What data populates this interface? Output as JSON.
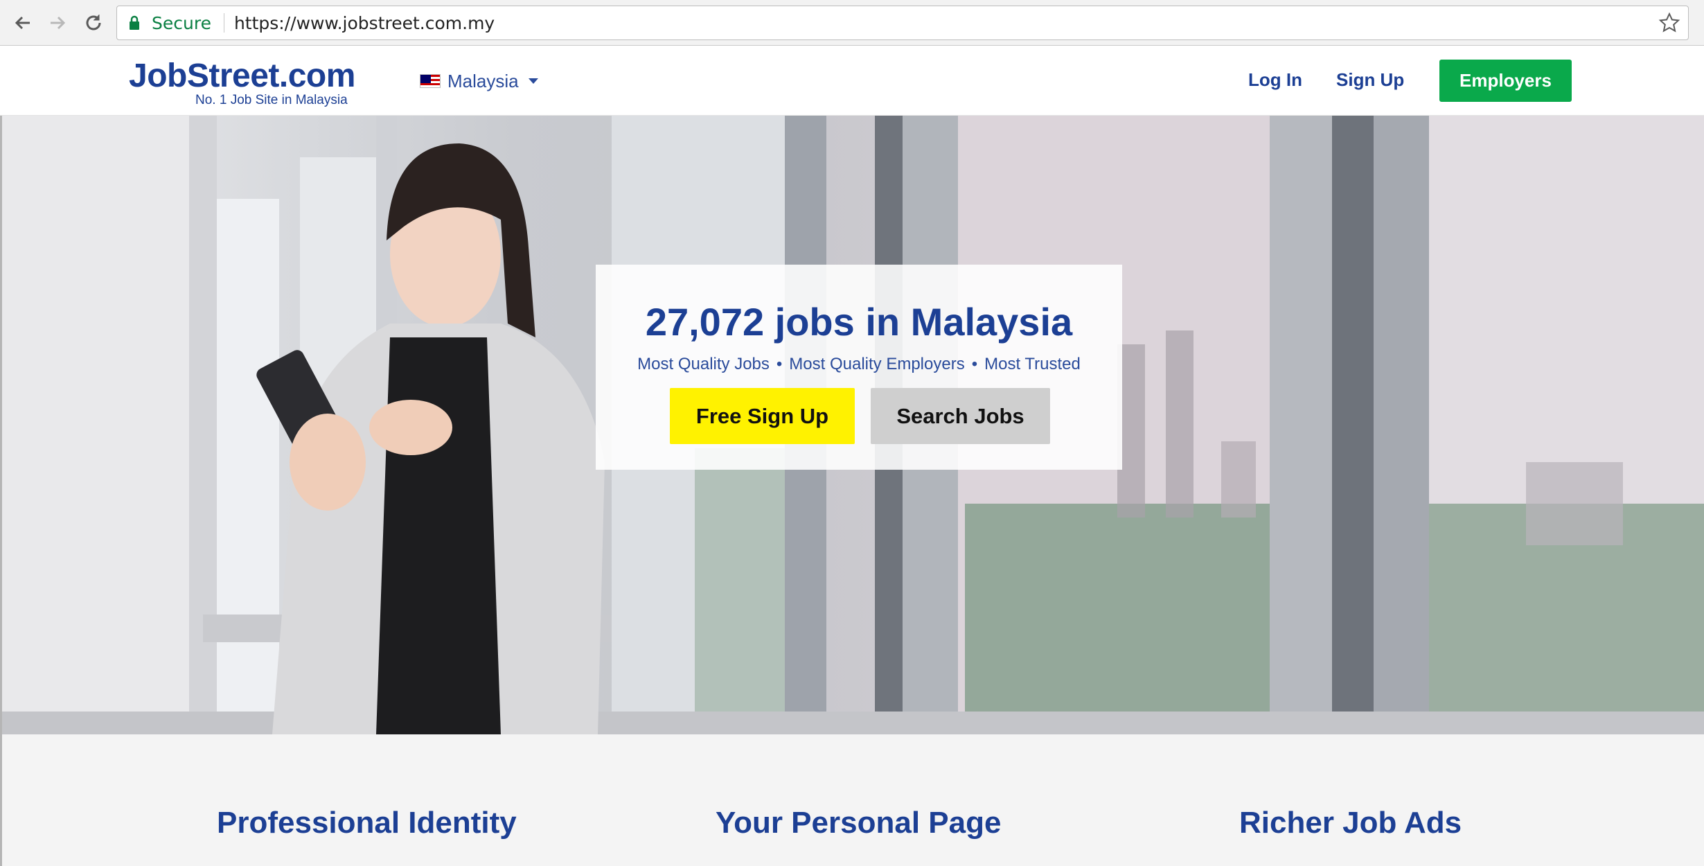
{
  "browser": {
    "secure_label": "Secure",
    "url": "https://www.jobstreet.com.my"
  },
  "header": {
    "logo_text": "JobStreet.com",
    "logo_tagline": "No. 1 Job Site in Malaysia",
    "country": "Malaysia",
    "login_label": "Log In",
    "signup_label": "Sign Up",
    "employers_label": "Employers"
  },
  "hero": {
    "title": "27,072 jobs in Malaysia",
    "taglines": [
      "Most Quality Jobs",
      "Most Quality Employers",
      "Most Trusted"
    ],
    "separator": "•",
    "signup_button": "Free Sign Up",
    "search_button": "Search Jobs"
  },
  "features": {
    "items": [
      "Professional Identity",
      "Your Personal Page",
      "Richer Job Ads"
    ]
  },
  "colors": {
    "brand_blue": "#1c3f94",
    "employers_green": "#0aa94b",
    "signup_yellow": "#fff200",
    "secure_green": "#0b8043"
  },
  "icons": [
    "back-arrow-icon",
    "forward-arrow-icon",
    "reload-icon",
    "lock-icon",
    "star-icon",
    "malaysia-flag-icon",
    "caret-down-icon"
  ]
}
